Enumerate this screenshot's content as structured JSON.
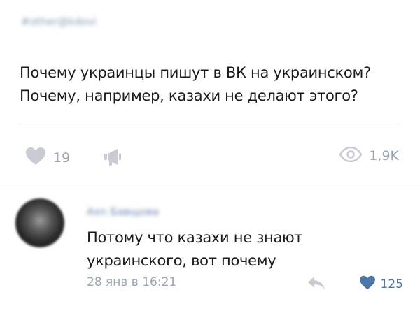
{
  "post": {
    "author": "#other@kdovi",
    "text_lines": [
      "Почему украинцы пишут в ВК на украинском?",
      "Почему, например, казахи не делают этого?"
    ],
    "likes": "19",
    "views": "1,9K"
  },
  "comment": {
    "author": "Axn Бaвщoвa",
    "text_lines": [
      "Потому что казахи не знают",
      "украинского, вот почему"
    ],
    "timestamp": "28 янв в 16:21",
    "likes": "125"
  },
  "colors": {
    "accent": "#4a76a8",
    "muted": "#9aa5b1",
    "icon_grey": "#c8ccd2"
  },
  "icons": [
    "heart-icon",
    "share-icon",
    "eye-icon",
    "reply-icon",
    "heart-filled-icon"
  ]
}
